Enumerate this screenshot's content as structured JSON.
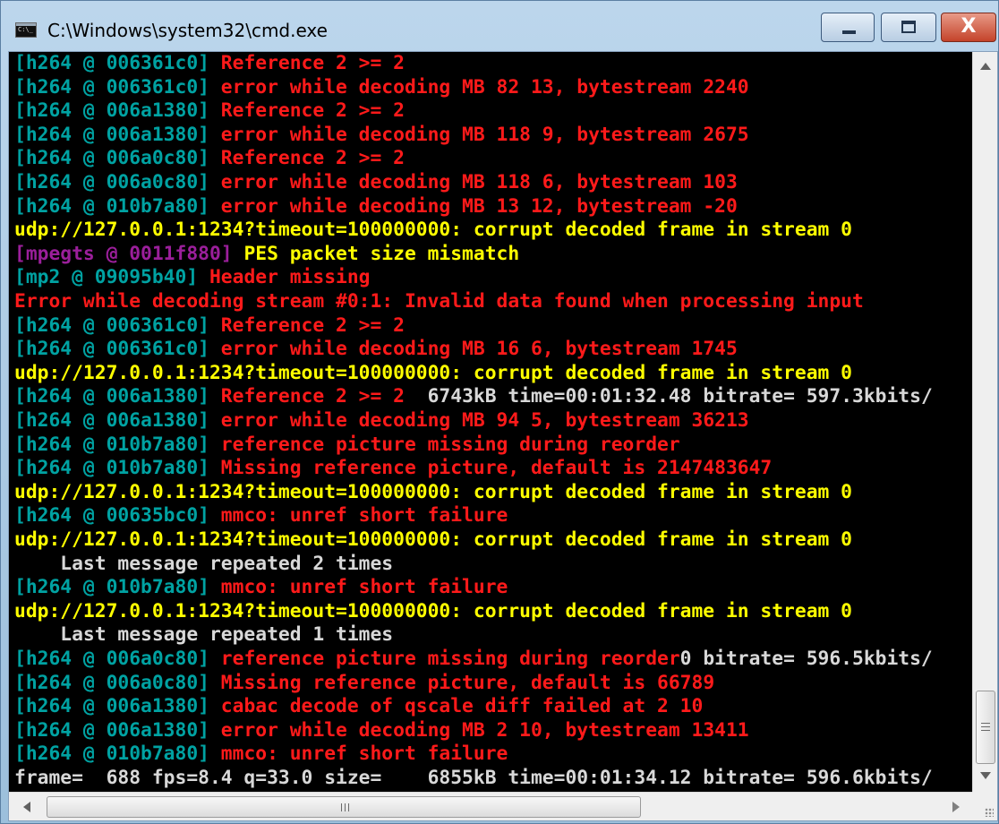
{
  "window": {
    "title": "C:\\Windows\\system32\\cmd.exe",
    "icon": "console-icon",
    "controls": {
      "minimize": "minimize-icon",
      "maximize": "maximize-icon",
      "close_glyph": "X"
    }
  },
  "colors": {
    "cyan": "#00a2a2",
    "red": "#ff1a1a",
    "yellow": "#ffff00",
    "purple": "#9b1f9b",
    "white": "#d8d8d8",
    "background": "#000000"
  },
  "console": {
    "lines": [
      {
        "segments": [
          {
            "text": "[h264 @ 006361c0] ",
            "color": "cyan"
          },
          {
            "text": "Reference 2 >= 2",
            "color": "red"
          }
        ]
      },
      {
        "segments": [
          {
            "text": "[h264 @ 006361c0] ",
            "color": "cyan"
          },
          {
            "text": "error while decoding MB 82 13, bytestream 2240",
            "color": "red"
          }
        ]
      },
      {
        "segments": [
          {
            "text": "[h264 @ 006a1380] ",
            "color": "cyan"
          },
          {
            "text": "Reference 2 >= 2",
            "color": "red"
          }
        ]
      },
      {
        "segments": [
          {
            "text": "[h264 @ 006a1380] ",
            "color": "cyan"
          },
          {
            "text": "error while decoding MB 118 9, bytestream 2675",
            "color": "red"
          }
        ]
      },
      {
        "segments": [
          {
            "text": "[h264 @ 006a0c80] ",
            "color": "cyan"
          },
          {
            "text": "Reference 2 >= 2",
            "color": "red"
          }
        ]
      },
      {
        "segments": [
          {
            "text": "[h264 @ 006a0c80] ",
            "color": "cyan"
          },
          {
            "text": "error while decoding MB 118 6, bytestream 103",
            "color": "red"
          }
        ]
      },
      {
        "segments": [
          {
            "text": "[h264 @ 010b7a80] ",
            "color": "cyan"
          },
          {
            "text": "error while decoding MB 13 12, bytestream -20",
            "color": "red"
          }
        ]
      },
      {
        "segments": [
          {
            "text": "udp://127.0.0.1:1234?timeout=100000000: corrupt decoded frame in stream 0",
            "color": "yellow"
          }
        ]
      },
      {
        "segments": [
          {
            "text": "[mpegts @ 0011f880] ",
            "color": "purple"
          },
          {
            "text": "PES packet size mismatch",
            "color": "yellow"
          }
        ]
      },
      {
        "segments": [
          {
            "text": "[mp2 @ 09095b40] ",
            "color": "cyan"
          },
          {
            "text": "Header missing",
            "color": "red"
          }
        ]
      },
      {
        "segments": [
          {
            "text": "Error while decoding stream #0:1: Invalid data found when processing input",
            "color": "red"
          }
        ]
      },
      {
        "segments": [
          {
            "text": "[h264 @ 006361c0] ",
            "color": "cyan"
          },
          {
            "text": "Reference 2 >= 2",
            "color": "red"
          }
        ]
      },
      {
        "segments": [
          {
            "text": "[h264 @ 006361c0] ",
            "color": "cyan"
          },
          {
            "text": "error while decoding MB 16 6, bytestream 1745",
            "color": "red"
          }
        ]
      },
      {
        "segments": [
          {
            "text": "udp://127.0.0.1:1234?timeout=100000000: corrupt decoded frame in stream 0",
            "color": "yellow"
          }
        ]
      },
      {
        "segments": [
          {
            "text": "[h264 @ 006a1380] ",
            "color": "cyan"
          },
          {
            "text": "Reference 2 >= 2 ",
            "color": "red"
          },
          {
            "text": " 6743kB time=00:01:32.48 bitrate= 597.3kbits/",
            "color": "white"
          }
        ]
      },
      {
        "segments": [
          {
            "text": "[h264 @ 006a1380] ",
            "color": "cyan"
          },
          {
            "text": "error while decoding MB 94 5, bytestream 36213",
            "color": "red"
          }
        ]
      },
      {
        "segments": [
          {
            "text": "[h264 @ 010b7a80] ",
            "color": "cyan"
          },
          {
            "text": "reference picture missing during reorder",
            "color": "red"
          }
        ]
      },
      {
        "segments": [
          {
            "text": "[h264 @ 010b7a80] ",
            "color": "cyan"
          },
          {
            "text": "Missing reference picture, default is 2147483647",
            "color": "red"
          }
        ]
      },
      {
        "segments": [
          {
            "text": "udp://127.0.0.1:1234?timeout=100000000: corrupt decoded frame in stream 0",
            "color": "yellow"
          }
        ]
      },
      {
        "segments": [
          {
            "text": "[h264 @ 00635bc0] ",
            "color": "cyan"
          },
          {
            "text": "mmco: unref short failure",
            "color": "red"
          }
        ]
      },
      {
        "segments": [
          {
            "text": "udp://127.0.0.1:1234?timeout=100000000: corrupt decoded frame in stream 0",
            "color": "yellow"
          }
        ]
      },
      {
        "segments": [
          {
            "text": "    Last message repeated 2 times",
            "color": "white"
          }
        ]
      },
      {
        "segments": [
          {
            "text": "[h264 @ 010b7a80] ",
            "color": "cyan"
          },
          {
            "text": "mmco: unref short failure",
            "color": "red"
          }
        ]
      },
      {
        "segments": [
          {
            "text": "udp://127.0.0.1:1234?timeout=100000000: corrupt decoded frame in stream 0",
            "color": "yellow"
          }
        ]
      },
      {
        "segments": [
          {
            "text": "    Last message repeated 1 times",
            "color": "white"
          }
        ]
      },
      {
        "segments": [
          {
            "text": "[h264 @ 006a0c80] ",
            "color": "cyan"
          },
          {
            "text": "reference picture missing during reorder",
            "color": "red"
          },
          {
            "text": "0 bitrate= 596.5kbits/",
            "color": "white"
          }
        ]
      },
      {
        "segments": [
          {
            "text": "[h264 @ 006a0c80] ",
            "color": "cyan"
          },
          {
            "text": "Missing reference picture, default is 66789",
            "color": "red"
          }
        ]
      },
      {
        "segments": [
          {
            "text": "[h264 @ 006a1380] ",
            "color": "cyan"
          },
          {
            "text": "cabac decode of qscale diff failed at 2 10",
            "color": "red"
          }
        ]
      },
      {
        "segments": [
          {
            "text": "[h264 @ 006a1380] ",
            "color": "cyan"
          },
          {
            "text": "error while decoding MB 2 10, bytestream 13411",
            "color": "red"
          }
        ]
      },
      {
        "segments": [
          {
            "text": "[h264 @ 010b7a80] ",
            "color": "cyan"
          },
          {
            "text": "mmco: unref short failure",
            "color": "red"
          }
        ]
      },
      {
        "segments": [
          {
            "text": "frame=  688 fps=8.4 q=33.0 size=    6855kB time=00:01:34.12 bitrate= 596.6kbits/",
            "color": "white"
          }
        ]
      }
    ]
  }
}
